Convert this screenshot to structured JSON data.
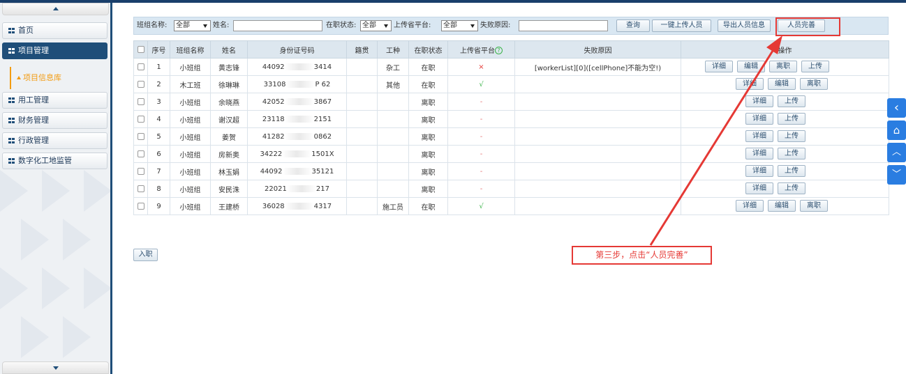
{
  "sidebar": {
    "items": [
      {
        "label": "首页",
        "active": false
      },
      {
        "label": "项目管理",
        "active": true
      },
      {
        "label": "项目信息库",
        "sub": true
      },
      {
        "label": "用工管理",
        "active": false
      },
      {
        "label": "财务管理",
        "active": false
      },
      {
        "label": "行政管理",
        "active": false
      },
      {
        "label": "数字化工地监管",
        "active": false
      }
    ]
  },
  "filters": {
    "team_label": "班组名称:",
    "team_value": "全部",
    "name_label": "姓名:",
    "status_label": "在职状态:",
    "status_value": "全部",
    "platform_label": "上传省平台:",
    "platform_value": "全部",
    "reason_label": "失败原因:"
  },
  "toolbar": {
    "query": "查询",
    "upload_all": "一键上传人员",
    "export": "导出人员信息",
    "complete": "人员完善"
  },
  "table": {
    "columns": [
      "序号",
      "班组名称",
      "姓名",
      "身份证号码",
      "籍贯",
      "工种",
      "在职状态",
      "上传省平台",
      "失败原因",
      "操作"
    ],
    "rows": [
      {
        "no": "1",
        "team": "小班组",
        "name": "黄志锋",
        "id_pre": "44092",
        "id_suf": "3414",
        "origin": "",
        "trade": "杂工",
        "status": "在职",
        "upload": "×",
        "reason": "[workerList][0]([cellPhone]不能为空!)",
        "ops": [
          "详细",
          "编辑",
          "离职",
          "上传"
        ]
      },
      {
        "no": "2",
        "team": "木工班",
        "name": "徐琳琳",
        "id_pre": "33108",
        "id_suf": "P 62",
        "origin": "",
        "trade": "其他",
        "status": "在职",
        "upload": "√",
        "reason": "",
        "ops": [
          "详细",
          "编辑",
          "离职"
        ]
      },
      {
        "no": "3",
        "team": "小班组",
        "name": "余晓燕",
        "id_pre": "42052",
        "id_suf": "3867",
        "origin": "",
        "trade": "",
        "status": "离职",
        "upload": "-",
        "reason": "",
        "ops": [
          "详细",
          "上传"
        ]
      },
      {
        "no": "4",
        "team": "小班组",
        "name": "谢汉超",
        "id_pre": "23118",
        "id_suf": "2151",
        "origin": "",
        "trade": "",
        "status": "离职",
        "upload": "-",
        "reason": "",
        "ops": [
          "详细",
          "上传"
        ]
      },
      {
        "no": "5",
        "team": "小班组",
        "name": "姜贺",
        "id_pre": "41282",
        "id_suf": "0862",
        "origin": "",
        "trade": "",
        "status": "离职",
        "upload": "-",
        "reason": "",
        "ops": [
          "详细",
          "上传"
        ]
      },
      {
        "no": "6",
        "team": "小班组",
        "name": "房新奥",
        "id_pre": "34222",
        "id_suf": "1501X",
        "origin": "",
        "trade": "",
        "status": "离职",
        "upload": "-",
        "reason": "",
        "ops": [
          "详细",
          "上传"
        ]
      },
      {
        "no": "7",
        "team": "小班组",
        "name": "林玉娟",
        "id_pre": "44092",
        "id_suf": "35121",
        "origin": "",
        "trade": "",
        "status": "离职",
        "upload": "-",
        "reason": "",
        "ops": [
          "详细",
          "上传"
        ]
      },
      {
        "no": "8",
        "team": "小班组",
        "name": "安民洙",
        "id_pre": "22021",
        "id_suf": "217",
        "origin": "",
        "trade": "",
        "status": "离职",
        "upload": "-",
        "reason": "",
        "ops": [
          "详细",
          "上传"
        ]
      },
      {
        "no": "9",
        "team": "小班组",
        "name": "王建桥",
        "id_pre": "36028",
        "id_suf": "4317",
        "origin": "",
        "trade": "施工员",
        "status": "在职",
        "upload": "√",
        "reason": "",
        "ops": [
          "详细",
          "编辑",
          "离职"
        ]
      }
    ]
  },
  "join_button": "入职",
  "annotation": "第三步，点击“人员完善”",
  "colors": {
    "accent": "#1f4e79",
    "callout": "#e53935",
    "ok": "#3bb44a",
    "side_tools": "#2a7de1"
  },
  "side_tools": [
    "chevron-left-icon",
    "home-icon",
    "chevron-up-icon",
    "chevron-down-icon"
  ]
}
